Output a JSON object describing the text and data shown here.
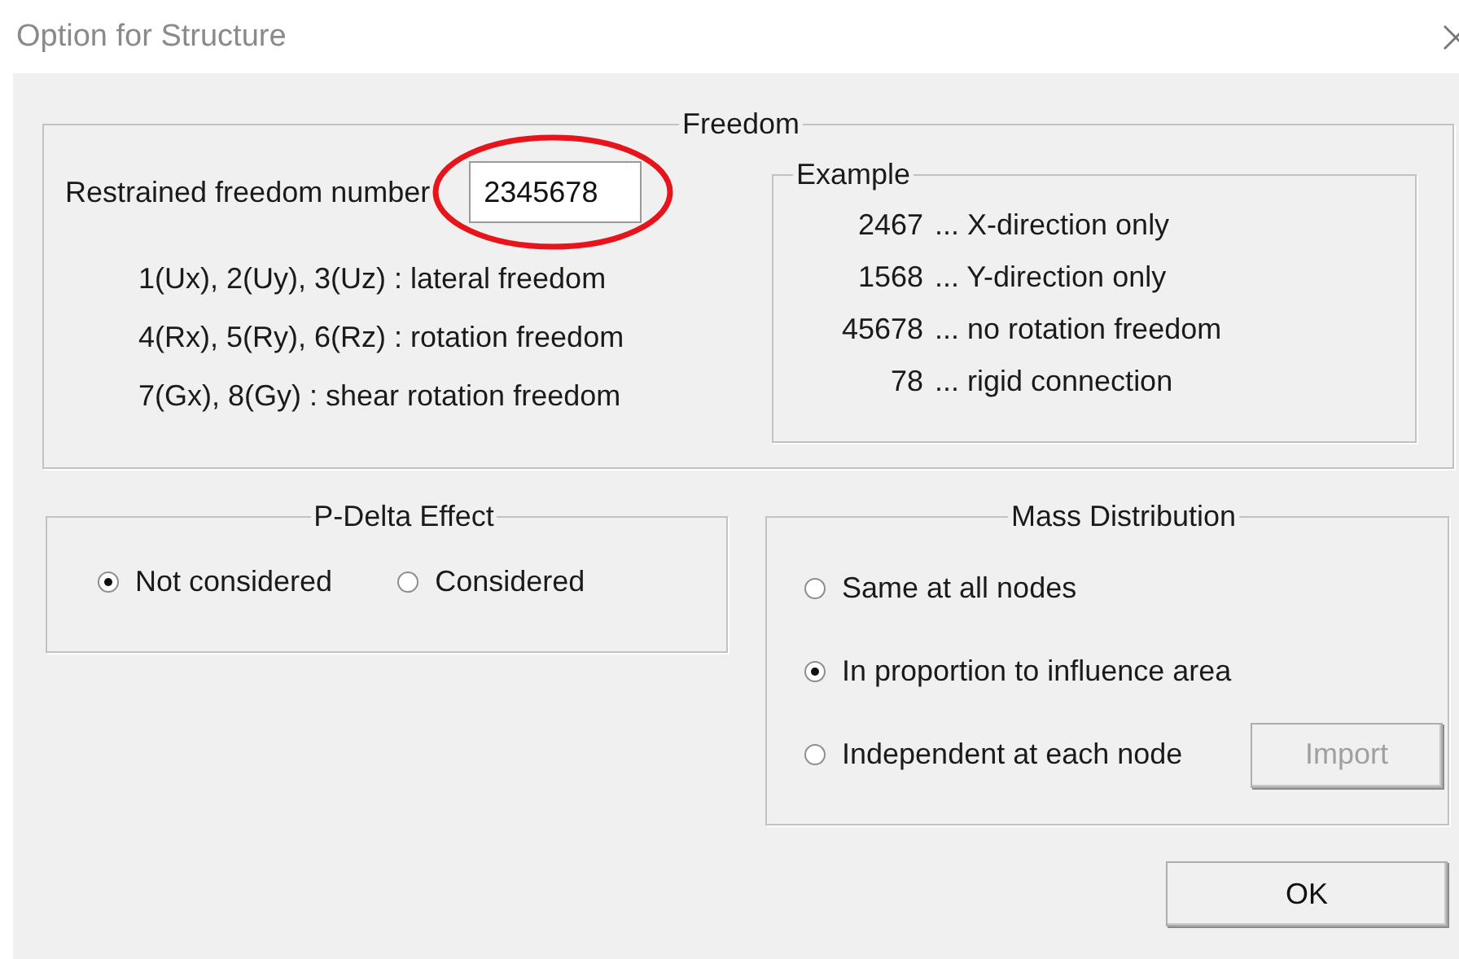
{
  "window": {
    "title": "Option for Structure"
  },
  "freedom": {
    "title": "Freedom",
    "field_label": "Restrained freedom number",
    "value": "2345678",
    "highlighted": true,
    "notes": [
      "1(Ux), 2(Uy), 3(Uz) : lateral freedom",
      "4(Rx), 5(Ry), 6(Rz) : rotation freedom",
      "7(Gx), 8(Gy) : shear rotation freedom"
    ],
    "example": {
      "title": "Example",
      "items": [
        {
          "code": "2467",
          "description": "... X-direction only"
        },
        {
          "code": "1568",
          "description": "... Y-direction only"
        },
        {
          "code": "45678",
          "description": "... no rotation freedom"
        },
        {
          "code": "78",
          "description": "... rigid connection"
        }
      ]
    }
  },
  "p_delta": {
    "title": "P-Delta Effect",
    "options": [
      {
        "label": "Not considered",
        "selected": true
      },
      {
        "label": "Considered",
        "selected": false
      }
    ]
  },
  "mass_distribution": {
    "title": "Mass Distribution",
    "options": [
      {
        "label": "Same at all nodes",
        "selected": false
      },
      {
        "label": "In proportion to influence area",
        "selected": true
      },
      {
        "label": "Independent at each node",
        "selected": false
      }
    ],
    "import_button": {
      "label": "Import",
      "disabled": true
    }
  },
  "buttons": [
    {
      "label": "OK"
    }
  ]
}
